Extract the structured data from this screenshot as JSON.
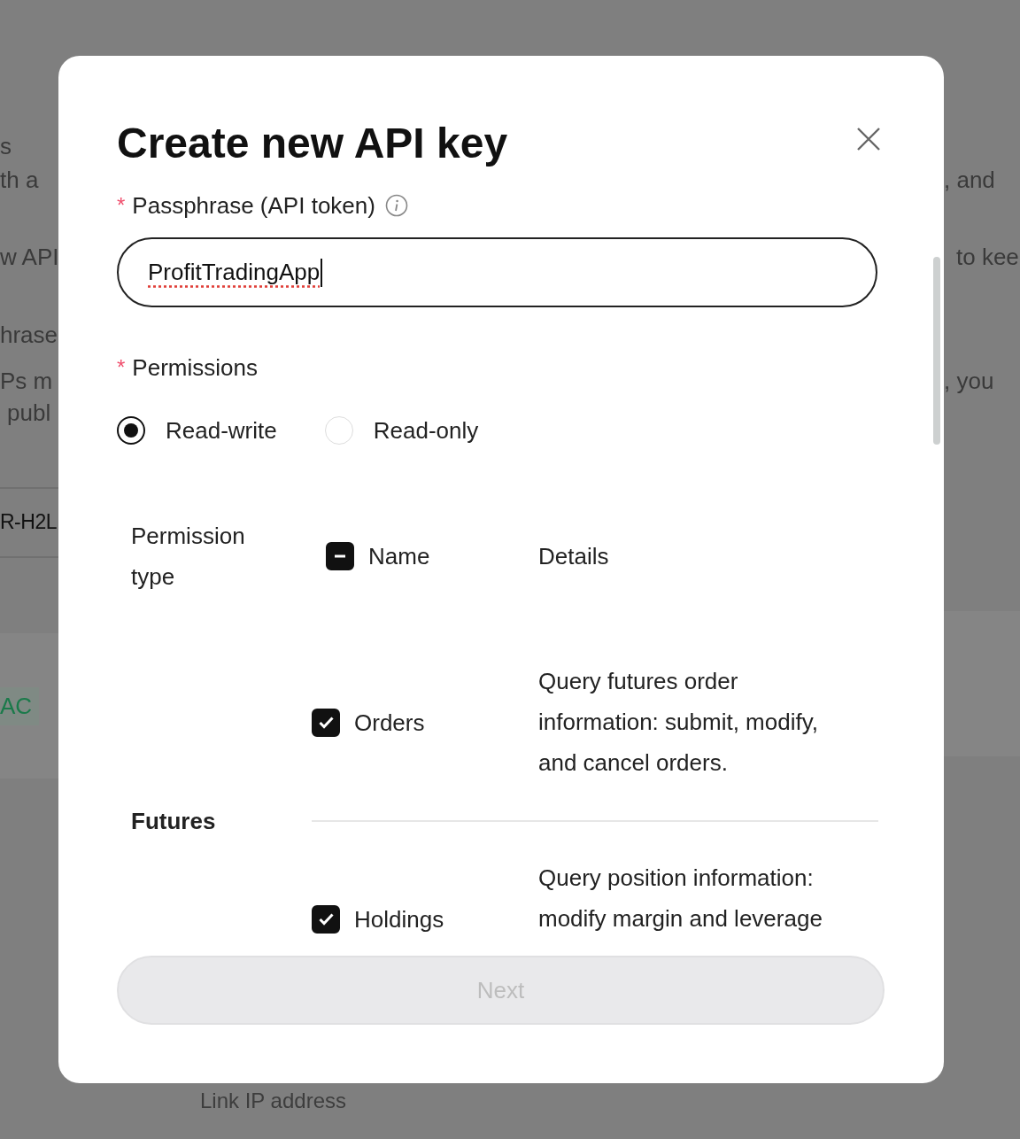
{
  "background": {
    "left_fragments": [
      "s",
      "th a",
      "w API",
      "hrase",
      "Ps m",
      "publ"
    ],
    "right_fragments": [
      ", and",
      "to kee",
      ", you"
    ],
    "row_label": "R-H2L",
    "tag": "AC",
    "footer_link": "Link IP address"
  },
  "dialog": {
    "title": "Create new API key",
    "passphrase": {
      "required_mark": "*",
      "label": "Passphrase (API token)",
      "value": "ProfitTradingApp"
    },
    "permissions": {
      "required_mark": "*",
      "label": "Permissions",
      "options": [
        {
          "label": "Read-write",
          "selected": true
        },
        {
          "label": "Read-only",
          "selected": false
        }
      ]
    },
    "table": {
      "columns": [
        "Permission type",
        "Name",
        "Details"
      ],
      "header_indeterminate": true,
      "groups": [
        {
          "name": "Futures",
          "rows": [
            {
              "name": "Orders",
              "checked": true,
              "details": "Query futures order information: submit, modify, and cancel orders."
            },
            {
              "name": "Holdings",
              "checked": true,
              "details": "Query position information: modify margin and leverage"
            }
          ]
        }
      ]
    },
    "next_button": {
      "label": "Next",
      "disabled": true
    }
  }
}
